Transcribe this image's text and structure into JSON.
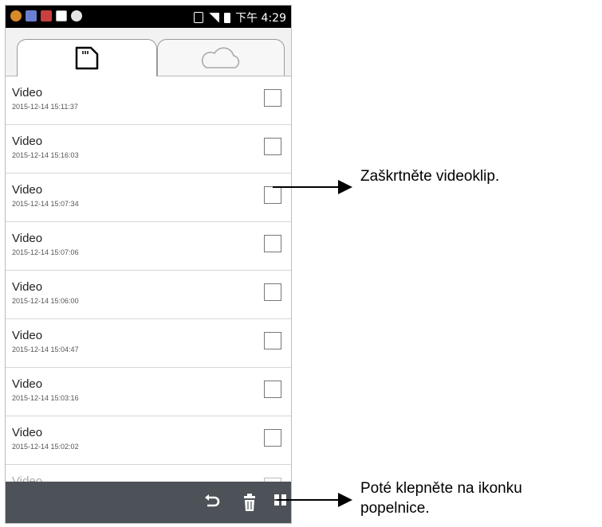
{
  "status_bar": {
    "time": "下午 4:29"
  },
  "tabs": [
    {
      "icon": "sd-card-icon",
      "selected": true
    },
    {
      "icon": "cloud-icon",
      "selected": false
    }
  ],
  "videos": [
    {
      "title": "Video",
      "date": "2015-12-14 15:11:37",
      "checked": false
    },
    {
      "title": "Video",
      "date": "2015-12-14 15:16:03",
      "checked": false
    },
    {
      "title": "Video",
      "date": "2015-12-14 15:07:34",
      "checked": false
    },
    {
      "title": "Video",
      "date": "2015-12-14 15:07:06",
      "checked": false
    },
    {
      "title": "Video",
      "date": "2015-12-14 15:06:00",
      "checked": false
    },
    {
      "title": "Video",
      "date": "2015-12-14 15:04:47",
      "checked": false
    },
    {
      "title": "Video",
      "date": "2015-12-14 15:03:16",
      "checked": false
    },
    {
      "title": "Video",
      "date": "2015-12-14 15:02:02",
      "checked": false
    },
    {
      "title": "Video",
      "date": "",
      "checked": false
    }
  ],
  "bottom_bar": {
    "icons": [
      "undo-icon",
      "trash-icon",
      "grid-icon"
    ]
  },
  "annotations": {
    "check_hint": "Zaškrtněte videoklip.",
    "trash_hint_line1": "Poté klepněte na ikonku",
    "trash_hint_line2": "popelnice."
  },
  "colors": {
    "bottom_bar": "#4c5257",
    "status_bar": "#000000"
  }
}
